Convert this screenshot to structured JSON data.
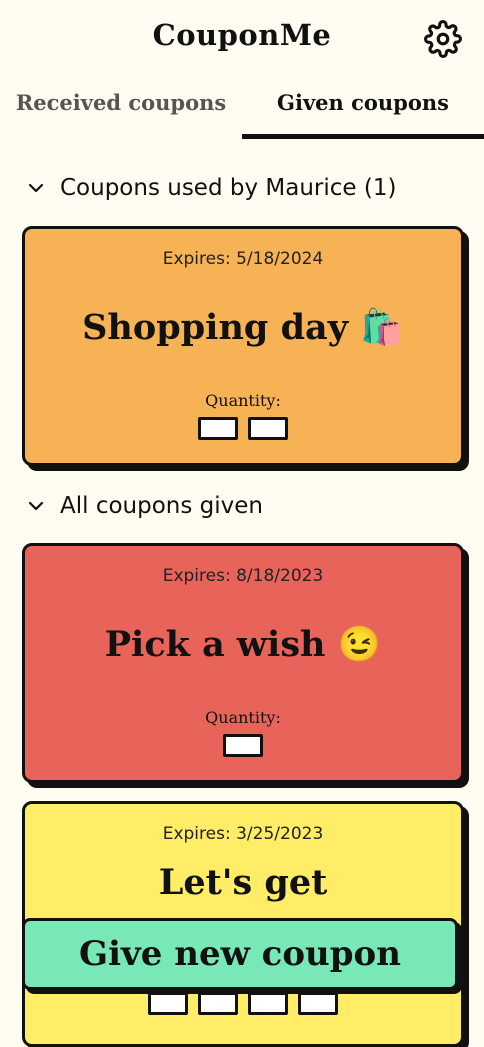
{
  "app": {
    "title": "CouponMe"
  },
  "tabs": [
    {
      "label": "Received coupons",
      "active": false
    },
    {
      "label": "Given coupons",
      "active": true
    }
  ],
  "sections": {
    "used": {
      "label": "Coupons used by Maurice (1)"
    },
    "all": {
      "label": "All coupons given"
    }
  },
  "coupons": [
    {
      "expires": "Expires: 5/18/2024",
      "title": "Shopping day 🛍️",
      "quantity_label": "Quantity:",
      "quantity": 2,
      "color": "#f6b255"
    },
    {
      "expires": "Expires: 8/18/2023",
      "title": "Pick a wish 😉",
      "quantity_label": "Quantity:",
      "quantity": 1,
      "color": "#e8635a"
    },
    {
      "expires": "Expires: 3/25/2023",
      "title": "Let's get",
      "quantity": 4,
      "color": "#ffec67"
    }
  ],
  "action": {
    "give_label": "Give new coupon"
  },
  "icons": {
    "settings": "gear-icon",
    "collapse": "chevron-down-icon"
  }
}
